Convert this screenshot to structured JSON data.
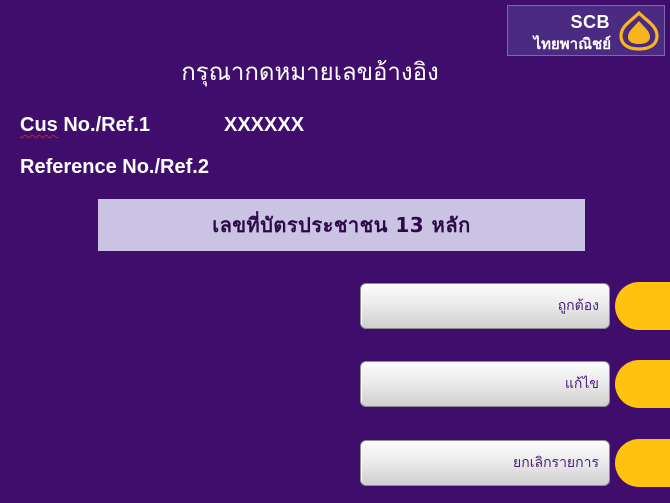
{
  "logo": {
    "brand": "SCB",
    "thai_name": "ไทยพาณิชย์",
    "emblem_icon": "scb-emblem-icon",
    "emblem_color": "#f8b51e"
  },
  "screen": {
    "title": "กรุณากดหมายเลขอ้างอิง",
    "ref1_label_prefix": "Cus",
    "ref1_label_suffix": " No./Ref.1",
    "ref1_value": "XXXXXX",
    "ref2_label": "Reference No./Ref.2",
    "id_box_text": "เลขที่บัตรประชาชน 13 หลัก"
  },
  "menu": [
    {
      "label": "ถูกต้อง"
    },
    {
      "label": "แก้ไข"
    },
    {
      "label": "ยกเลิกรายการ"
    }
  ],
  "colors": {
    "background": "#3f0d6b",
    "id_box": "#cbc3e3",
    "side_key": "#ffc20e",
    "button_text": "#4a1e7a"
  }
}
